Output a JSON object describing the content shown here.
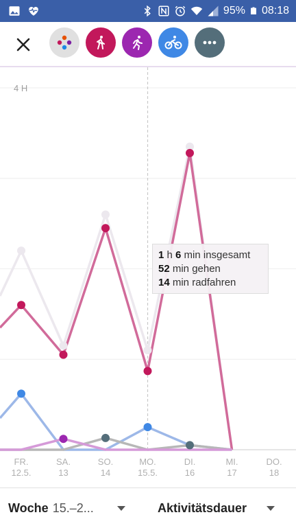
{
  "status_bar": {
    "battery_percent": "95%",
    "time": "08:18",
    "left_icons": [
      "image-icon",
      "heart-pulse-icon"
    ],
    "right_icons": [
      "bluetooth-icon",
      "nfc-icon",
      "alarm-icon",
      "wifi-icon",
      "signal-icon",
      "battery-icon"
    ]
  },
  "toolbar": {
    "close_icon": "close-icon",
    "activity_filters": [
      {
        "name": "all-activities",
        "color": "#e0e0e0",
        "icon": "multicolor-dots-icon"
      },
      {
        "name": "walking",
        "color": "#c2185b",
        "icon": "walking-icon"
      },
      {
        "name": "running",
        "color": "#9c27b0",
        "icon": "running-icon"
      },
      {
        "name": "cycling",
        "color": "#3f88e5",
        "icon": "cycling-icon"
      },
      {
        "name": "more",
        "color": "#546e7a",
        "icon": "more-horiz-icon"
      }
    ]
  },
  "chart_data": {
    "type": "line",
    "y_axis_label": "4 H",
    "ylim": [
      0,
      4
    ],
    "ylabel_unit": "hours",
    "categories": [
      "FR.\n12.5.",
      "SA.\n13",
      "SO.\n14",
      "MO.\n15.5.",
      "DI.\n16",
      "MI.\n17",
      "DO.\n18"
    ],
    "x_tick_days": [
      "FR.",
      "SA.",
      "SO.",
      "MO.",
      "DI.",
      "MI.",
      "DO."
    ],
    "x_tick_dates": [
      "12.5.",
      "13",
      "14",
      "15.5.",
      "16",
      "17",
      "18"
    ],
    "gridlines": [
      0,
      1,
      2,
      3,
      4
    ],
    "series": [
      {
        "color": "#ece8ee",
        "values": [
          2.2,
          1.15,
          2.6,
          1.1,
          3.35,
          0,
          null
        ],
        "lead": 1.7
      },
      {
        "color": "#d16b9a",
        "values": [
          1.6,
          1.05,
          2.45,
          0.87,
          3.28,
          0,
          null
        ],
        "lead": 1.35
      },
      {
        "color": "#9db8e8",
        "values": [
          0.62,
          0,
          0,
          0.25,
          0.05,
          0,
          null
        ],
        "lead": 0.35
      },
      {
        "color": "#b7b7b7",
        "values": [
          0,
          0,
          0.13,
          0,
          0.05,
          0,
          null
        ],
        "lead": 0
      },
      {
        "color": "#d59ad8",
        "values": [
          0,
          0.12,
          0,
          0,
          0,
          0,
          null
        ],
        "lead": 0
      }
    ],
    "markers": [
      {
        "color": "#ece8ee",
        "points": [
          [
            0,
            2.2
          ],
          [
            1,
            1.15
          ],
          [
            2,
            2.6
          ],
          [
            3,
            1.1
          ],
          [
            4,
            3.35
          ]
        ]
      },
      {
        "color": "#c2185b",
        "points": [
          [
            0,
            1.6
          ],
          [
            1,
            1.05
          ],
          [
            2,
            2.45
          ],
          [
            3,
            0.87
          ],
          [
            4,
            3.28
          ]
        ]
      },
      {
        "color": "#3f88e5",
        "points": [
          [
            0,
            0.62
          ],
          [
            3,
            0.25
          ]
        ]
      },
      {
        "color": "#546e7a",
        "points": [
          [
            2,
            0.13
          ],
          [
            4,
            0.05
          ]
        ]
      },
      {
        "color": "#9c27b0",
        "points": [
          [
            1,
            0.12
          ]
        ]
      }
    ],
    "selected_index": 3
  },
  "tooltip": {
    "line1_h": "1",
    "line1_h_unit": " h ",
    "line1_min": "6",
    "line1_rest": " min insgesamt",
    "line2_num": "52",
    "line2_rest": " min gehen",
    "line3_num": "14",
    "line3_rest": " min radfahren"
  },
  "bottom_bar": {
    "period_label": "Woche",
    "period_value": "15.–2...",
    "metric_label": "Aktivitätsdauer"
  }
}
